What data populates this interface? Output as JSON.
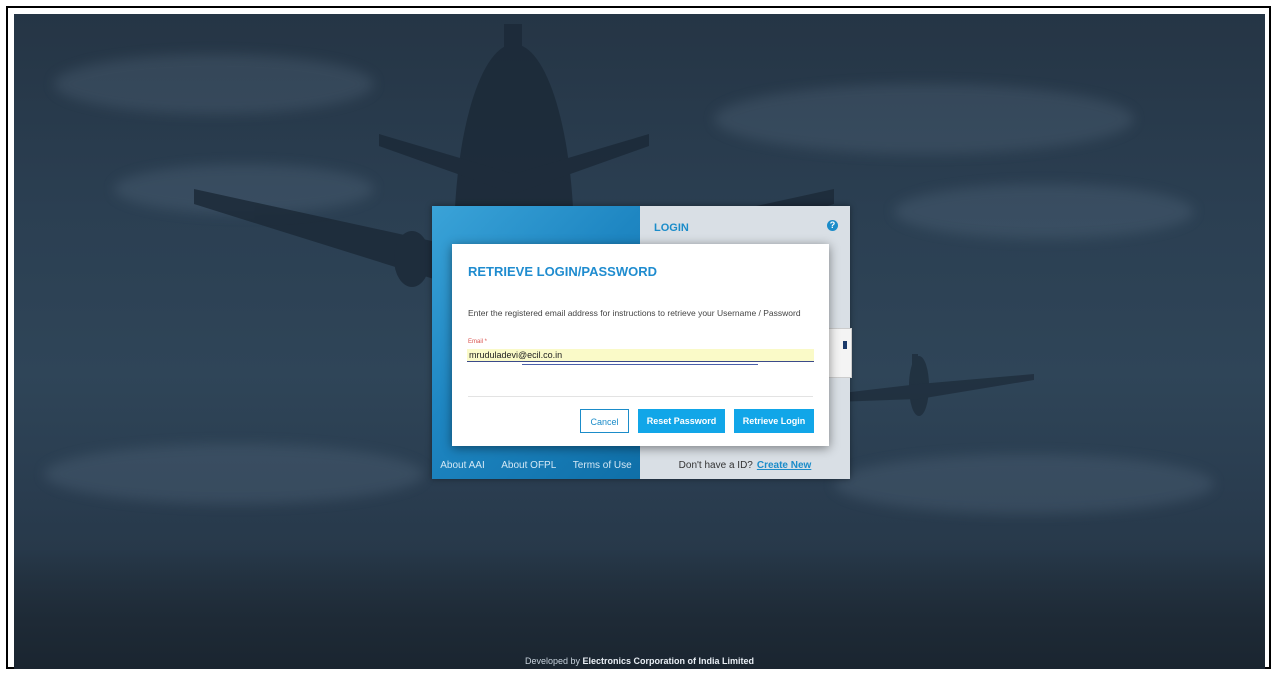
{
  "background": {
    "colors": {
      "sky_top": "#253545",
      "sky_mid": "#2f4558",
      "ground": "#1a2530"
    }
  },
  "login": {
    "title": "LOGIN",
    "help_icon": "question-circle-icon",
    "footer_links": [
      "About AAI",
      "About OFPL",
      "Terms of Use"
    ],
    "no_id_text": "Don't have a ID?",
    "create_new": "Create New",
    "accent": "#1b8cc9"
  },
  "modal": {
    "title": "RETRIEVE LOGIN/PASSWORD",
    "description": "Enter the registered email address for instructions to retrieve your Username / Password",
    "email_label": "Email *",
    "email_value": "mruduladevi@ecil.co.in",
    "buttons": {
      "cancel": "Cancel",
      "reset": "Reset Password",
      "retrieve": "Retrieve Login"
    },
    "button_color": "#11a6e8"
  },
  "footer": {
    "prefix": "Developed by",
    "company": "Electronics Corporation of India Limited"
  }
}
